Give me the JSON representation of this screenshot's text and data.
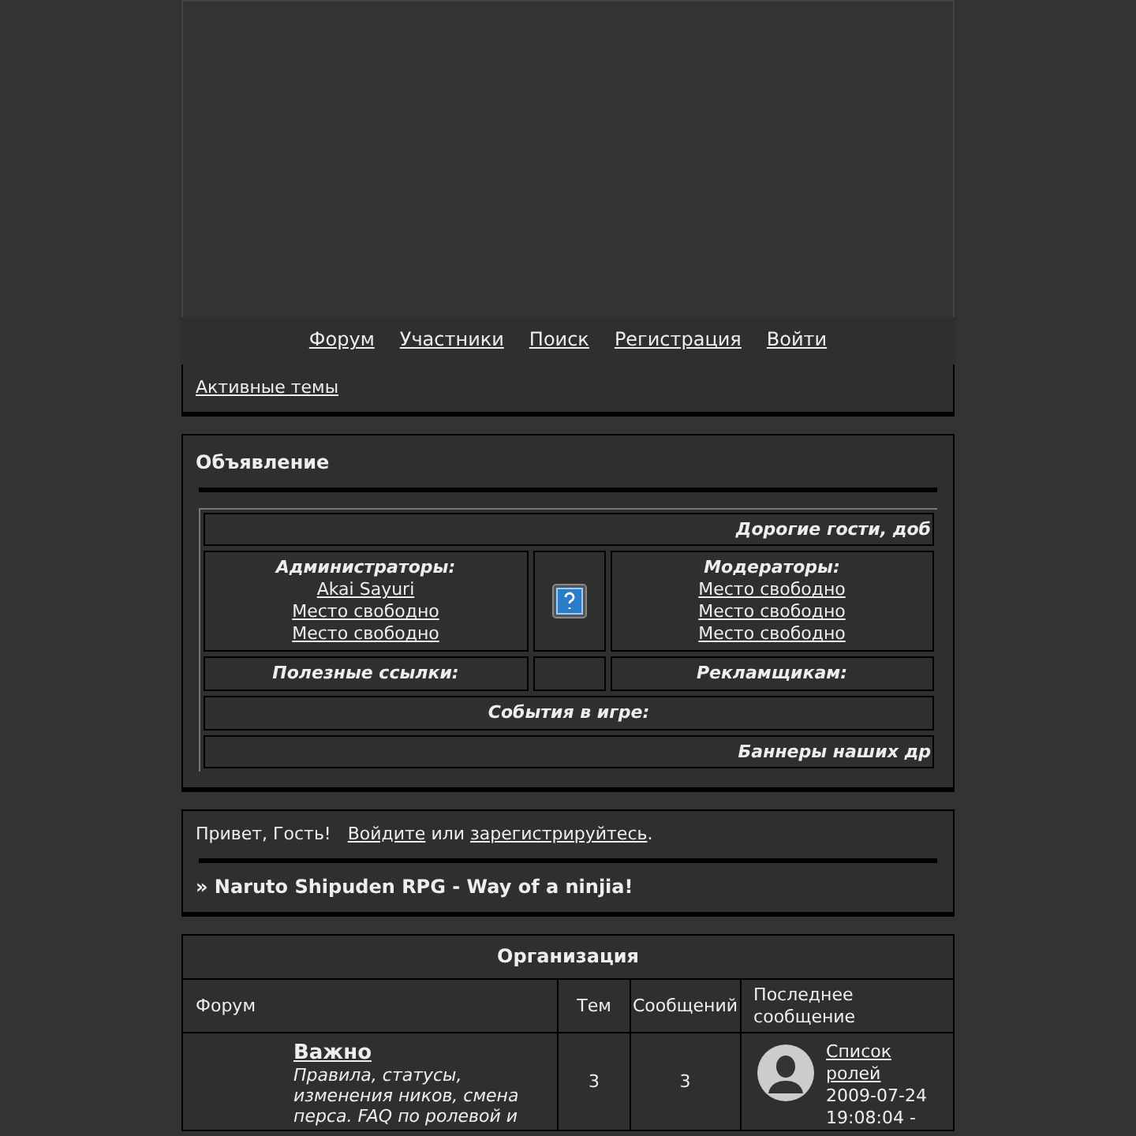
{
  "nav": {
    "links": [
      "Форум",
      "Участники",
      "Поиск",
      "Регистрация",
      "Войти"
    ]
  },
  "active_topics": "Активные темы",
  "announcement": {
    "title": "Объявление",
    "marquee": "Дорогие гости, доб",
    "admins": {
      "heading": "Администраторы:",
      "links": [
        "Akai Sayuri",
        "Место свободно",
        "Место свободно"
      ]
    },
    "moderators": {
      "heading": "Модераторы:",
      "links": [
        "Место свободно",
        "Место свободно",
        "Место свободно"
      ]
    },
    "useful_links": "Полезные ссылки:",
    "advertisers": "Рекламщикам:",
    "events": "События в игре:",
    "banners": "Баннеры наших др"
  },
  "greeting": {
    "hello": "Привет, Гость!",
    "login": "Войдите",
    "or": "или",
    "register": "зарегистрируйтесь",
    "end": "."
  },
  "board_title": "» Naruto Shipuden RPG - Way of a ninjia!",
  "category": {
    "title": "Организация",
    "columns": [
      "Форум",
      "Тем",
      "Сообщений",
      "Последнее сообщение"
    ],
    "rows": [
      {
        "name": "Важно",
        "description": "Правила, статусы, изменения ников, смена перса. FAQ по ролевой и",
        "topics": "3",
        "posts": "3",
        "last_topic": "Список ролей",
        "last_date": "2009-07-24",
        "last_time": "19:08:04 -"
      }
    ]
  }
}
